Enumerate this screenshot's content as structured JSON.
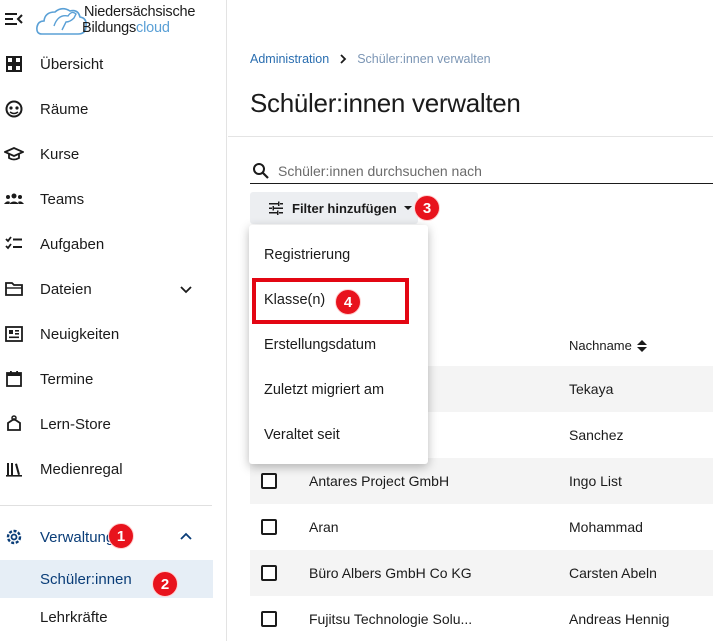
{
  "brand": {
    "line1": "Niedersächsische",
    "line2_a": "Bildungs",
    "line2_b": "cloud"
  },
  "sidebar": {
    "items": [
      {
        "label": "Übersicht",
        "icon": "dashboard-icon"
      },
      {
        "label": "Räume",
        "icon": "rooms-icon"
      },
      {
        "label": "Kurse",
        "icon": "graduation-cap-icon"
      },
      {
        "label": "Teams",
        "icon": "teams-icon"
      },
      {
        "label": "Aufgaben",
        "icon": "tasks-icon"
      },
      {
        "label": "Dateien",
        "icon": "folder-icon"
      },
      {
        "label": "Neuigkeiten",
        "icon": "news-icon"
      },
      {
        "label": "Termine",
        "icon": "calendar-icon"
      },
      {
        "label": "Lern-Store",
        "icon": "lern-store-icon"
      },
      {
        "label": "Medienregal",
        "icon": "media-shelf-icon"
      },
      {
        "label": "Verwaltung",
        "icon": "gear-icon"
      }
    ],
    "sub_items": [
      {
        "label": "Schüler:innen",
        "active": true
      },
      {
        "label": "Lehrkräfte",
        "active": false
      }
    ]
  },
  "breadcrumb": {
    "parent": "Administration",
    "current": "Schüler:innen verwalten"
  },
  "page_title": "Schüler:innen verwalten",
  "search": {
    "placeholder": "Schüler:innen durchsuchen nach"
  },
  "filter_button": {
    "label": "Filter hinzufügen"
  },
  "filter_menu": {
    "options": [
      "Registrierung",
      "Klasse(n)",
      "Erstellungsdatum",
      "Zuletzt migriert am",
      "Veraltet seit"
    ]
  },
  "table": {
    "header_nachname": "Nachname",
    "rows": [
      {
        "vorname": "",
        "nachname": "Tekaya"
      },
      {
        "vorname": "",
        "nachname": "Sanchez"
      },
      {
        "vorname": "Antares Project GmbH",
        "nachname": "Ingo List"
      },
      {
        "vorname": "Aran",
        "nachname": "Mohammad"
      },
      {
        "vorname": "Büro Albers GmbH Co KG",
        "nachname": "Carsten Abeln"
      },
      {
        "vorname": "Fujitsu Technologie Solu...",
        "nachname": "Andreas Hennig"
      }
    ]
  },
  "annotations": {
    "step1": "1",
    "step2": "2",
    "step3": "3",
    "step4": "4"
  },
  "colors": {
    "accent": "#0a3d78",
    "link": "#2a6eb0",
    "badge": "#e8131d",
    "highlight": "#e30613",
    "active_bg": "#e6eef6"
  }
}
